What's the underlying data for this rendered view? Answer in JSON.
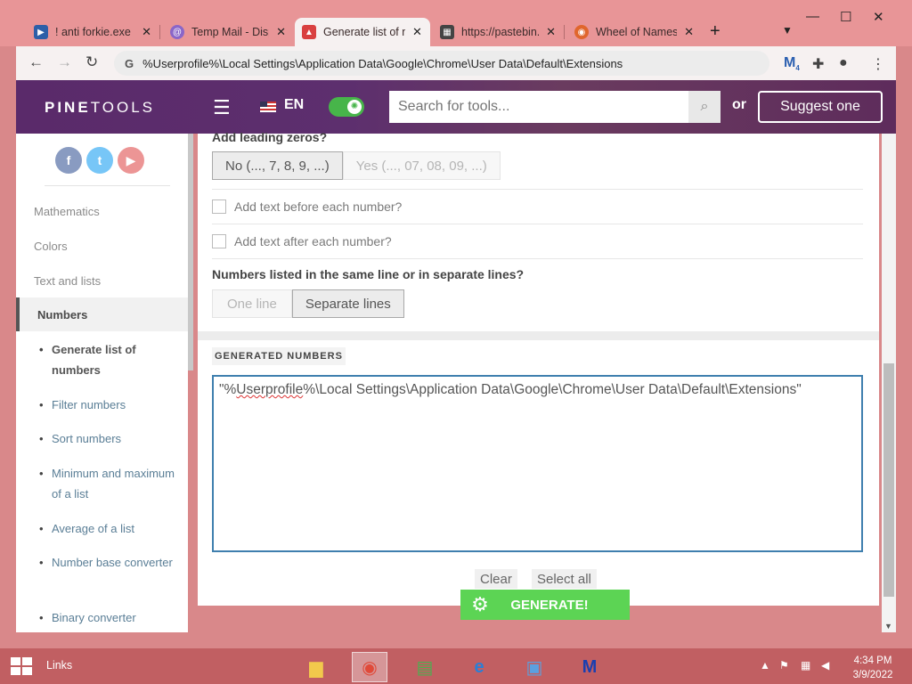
{
  "browser": {
    "tabs": [
      {
        "title": "! anti forkie.exe",
        "icon_color": "#2d5fa8",
        "glyph": "▶"
      },
      {
        "title": "Temp Mail - Disposable",
        "icon_color": "#8a66c8",
        "glyph": "@"
      },
      {
        "title": "Generate list of numbers",
        "icon_color": "#d94040",
        "glyph": "♣"
      },
      {
        "title": "https://pastebin.com",
        "icon_color": "#444444",
        "glyph": "▦"
      },
      {
        "title": "Wheel of Names",
        "icon_color": "#e0662d",
        "glyph": "◉"
      }
    ],
    "address": "%Userprofile%\\Local Settings\\Application Data\\Google\\Chrome\\User Data\\Default\\Extensions",
    "extension_badge": "4"
  },
  "site": {
    "logo_bold": "PINE",
    "logo_rest": "TOOLS",
    "language": "EN",
    "search_placeholder": "Search for tools...",
    "or_text": "or",
    "suggest_label": "Suggest one"
  },
  "sidebar": {
    "categories": [
      "Mathematics",
      "Colors",
      "Text and lists",
      "Numbers"
    ],
    "sub_items": [
      "Generate list of numbers",
      "Filter numbers",
      "Sort numbers",
      "Minimum and maximum of a list",
      "Average of a list",
      "Number base converter",
      "Binary converter"
    ]
  },
  "main": {
    "leading_zeros_label": "Add leading zeros?",
    "leading_no": "No (..., 7, 8, 9, ...)",
    "leading_yes": "Yes (..., 07, 08, 09, ...)",
    "text_before_label": "Add text before each number?",
    "text_after_label": "Add text after each number?",
    "lines_label": "Numbers listed in the same line or in separate lines?",
    "one_line": "One line",
    "separate_lines": "Separate lines",
    "generated_title": "GENERATED NUMBERS",
    "output_prefix": "\"%",
    "output_word": "Userprofile",
    "output_rest": "%\\Local Settings\\Application Data\\Google\\Chrome\\User Data\\Default\\Extensions\"",
    "clear_label": "Clear",
    "select_all_label": "Select all",
    "generate_label": "GENERATE!"
  },
  "taskbar": {
    "links_label": "Links",
    "time": "4:34 PM",
    "date": "3/9/2022"
  }
}
